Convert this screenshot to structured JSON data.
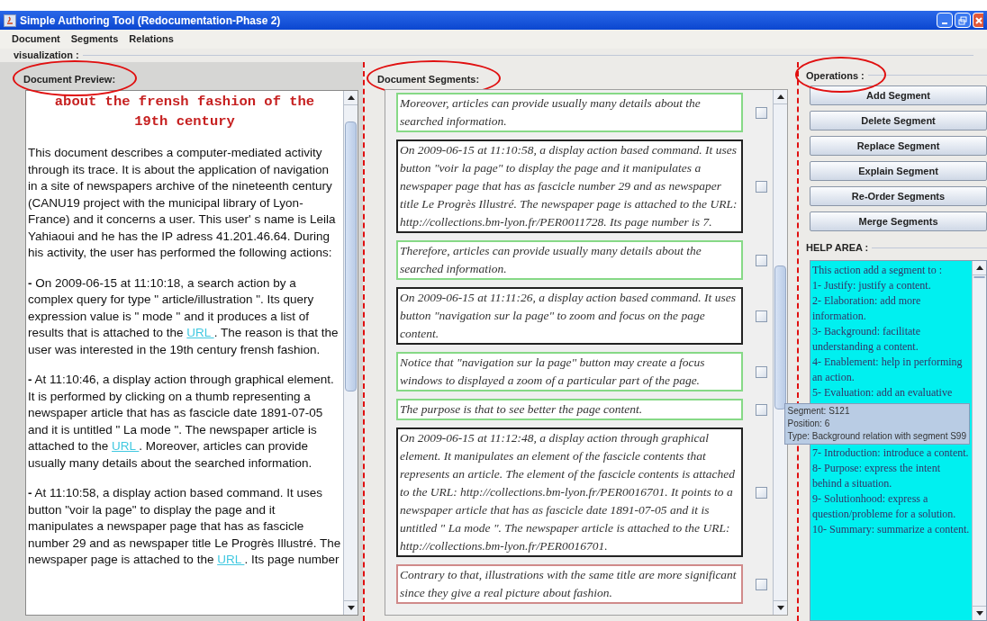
{
  "window": {
    "title": "Simple Authoring Tool (Redocumentation-Phase 2)"
  },
  "menu": [
    "Document",
    "Segments",
    "Relations"
  ],
  "visualization_label": "visualization :",
  "preview": {
    "label": "Document Preview:",
    "title": "about the frensh fashion of the 19th century",
    "paragraphs": [
      [
        {
          "kind": "text",
          "text": "This document describes a computer-mediated activity through its trace. It is about the application of navigation in a site of newspapers archive of the nineteenth century (CANU19 project with the municipal library of Lyon-France) and it concerns a user. This user' s name is Leila Yahiaoui and he has the IP adress 41.201.46.64. During his activity, the user has performed the following actions:"
        }
      ],
      [
        {
          "kind": "text",
          "text": "**-** On 2009-06-15 at 11:10:18, a search action by a complex query for type \" article/illustration \". Its query expression value is \" mode \" and it produces a list of results that is attached to the "
        },
        {
          "kind": "link",
          "text": "URL "
        },
        {
          "kind": "text",
          "text": ". The reason is that the user was interested in the 19th century frensh fashion."
        }
      ],
      [
        {
          "kind": "text",
          "text": "**-** At 11:10:46, a display action through graphical element. It is performed by clicking on a thumb representing a newspaper article that has as fascicle date 1891-07-05 and it is untitled \" La mode \". The newspaper article is attached to the "
        },
        {
          "kind": "link",
          "text": "URL "
        },
        {
          "kind": "text",
          "text": ". Moreover, articles can provide usually many details about the searched information."
        }
      ],
      [
        {
          "kind": "text",
          "text": "**-** At 11:10:58, a display action based command. It uses button \"voir la page\" to display the page and it manipulates a newspaper page that has as fascicle number 29 and as newspaper title Le Progrès Illustré. The newspaper page is attached to the "
        },
        {
          "kind": "link",
          "text": "URL "
        },
        {
          "kind": "text",
          "text": ". Its page number"
        }
      ]
    ]
  },
  "segments": {
    "label": "Document Segments:",
    "items": [
      {
        "text": "Moreover, articles can provide usually many details about the searched information.",
        "color": "#86d986",
        "checked": false
      },
      {
        "text": "On 2009-06-15 at 11:10:58, a display action based command. It uses button \"voir la page\" to display the page and it manipulates a newspaper page that has as fascicle number  29 and as newspaper title Le Progrès Illustré. The newspaper page is attached to the URL: http://collections.bm-lyon.fr/PER0011728. Its page number is 7.",
        "color": "#222222",
        "checked": false
      },
      {
        "text": "Therefore, articles can provide usually many details about the searched information.",
        "color": "#86d986",
        "checked": false
      },
      {
        "text": "On 2009-06-15 at 11:11:26, a display action based command. It uses button \"navigation sur la page\" to zoom and focus on the page content.",
        "color": "#222222",
        "checked": false
      },
      {
        "text": "Notice that \"navigation sur la page\" button may create a focus windows to displayed a zoom of a particular part of the page.",
        "color": "#86d986",
        "checked": false
      },
      {
        "text": "The purpose is that to see better the page content.",
        "color": "#86d986",
        "checked": false
      },
      {
        "text": "On 2009-06-15 at 11:12:48, a display action through graphical element. It manipulates an element of the fascicle contents that represents an article. The element of the fascicle contents is attached to the URL: http://collections.bm-lyon.fr/PER0016701. It points to a newspaper article that has as fascicle date 1891-07-05 and it is untitled \" La mode \". The newspaper article is attached to the URL: http://collections.bm-lyon.fr/PER0016701.",
        "color": "#222222",
        "checked": false
      },
      {
        "text": "Contrary to that, illustrations with the same title are more significant  since they give a real picture about fashion.",
        "color": "#d08a8a",
        "checked": false
      }
    ]
  },
  "tooltip": {
    "lines": [
      "Segment: S121",
      "Position: 6",
      "Type: Background relation with segment S99"
    ]
  },
  "operations": {
    "label": "Operations :",
    "buttons": [
      "Add Segment",
      "Delete Segment",
      "Replace Segment",
      "Explain Segment",
      "Re-Order Segments",
      "Merge Segments"
    ]
  },
  "help": {
    "label": "HELP AREA :",
    "lines_before": [
      "This action add a segment to :",
      "1- Justify: justify a content.",
      "2- Elaboration: add more information.",
      "3- Background: facilitate understanding a content.",
      "4- Enablement: help in performing an action.",
      "5- Evaluation: add an evaluative"
    ],
    "lines_after": [
      "7- Introduction: introduce a content.",
      "8- Purpose: express the intent behind a situation.",
      "9- Solutionhood: express a question/probleme for a solution.",
      "10- Summary: summarize a content."
    ]
  }
}
